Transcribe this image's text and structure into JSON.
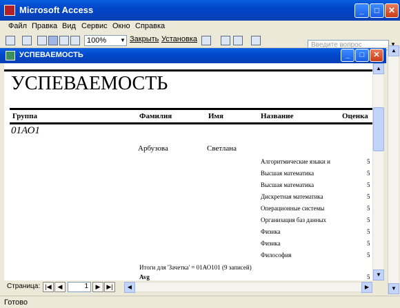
{
  "window": {
    "title": "Microsoft Access"
  },
  "menu": [
    "Файл",
    "Правка",
    "Вид",
    "Сервис",
    "Окно",
    "Справка"
  ],
  "help": {
    "placeholder": "Введите вопрос"
  },
  "toolbar": {
    "zoom": "100%",
    "close_label": "Закрыть",
    "setup_label": "Установка"
  },
  "document": {
    "title": "УСПЕВАЕМОСТЬ"
  },
  "report": {
    "title": "УСПЕВАЕМОСТЬ",
    "columns": [
      "Группа",
      "Фамилия",
      "Имя",
      "Название",
      "Оценка"
    ],
    "group": "01АО1",
    "student": {
      "surname": "Арбузова",
      "name": "Светлана"
    },
    "courses": [
      {
        "name": "Алгоритмические языки и",
        "grade": "5"
      },
      {
        "name": "Высшая математика",
        "grade": "5"
      },
      {
        "name": "Высшая математика",
        "grade": "5"
      },
      {
        "name": "Дискретная математика",
        "grade": "5"
      },
      {
        "name": "Операционные системы",
        "grade": "5"
      },
      {
        "name": "Организация баз данных",
        "grade": "5"
      },
      {
        "name": "Физика",
        "grade": "5"
      },
      {
        "name": "Физика",
        "grade": "5"
      },
      {
        "name": "Философия",
        "grade": "5"
      }
    ],
    "summary": "Итоги для 'Зачетка' =  01АО101 (9 записей)",
    "avg_label": "Avg",
    "avg_value": "5"
  },
  "nav": {
    "page_label": "Страница:",
    "page": "1"
  },
  "status": {
    "text": "Готово"
  }
}
